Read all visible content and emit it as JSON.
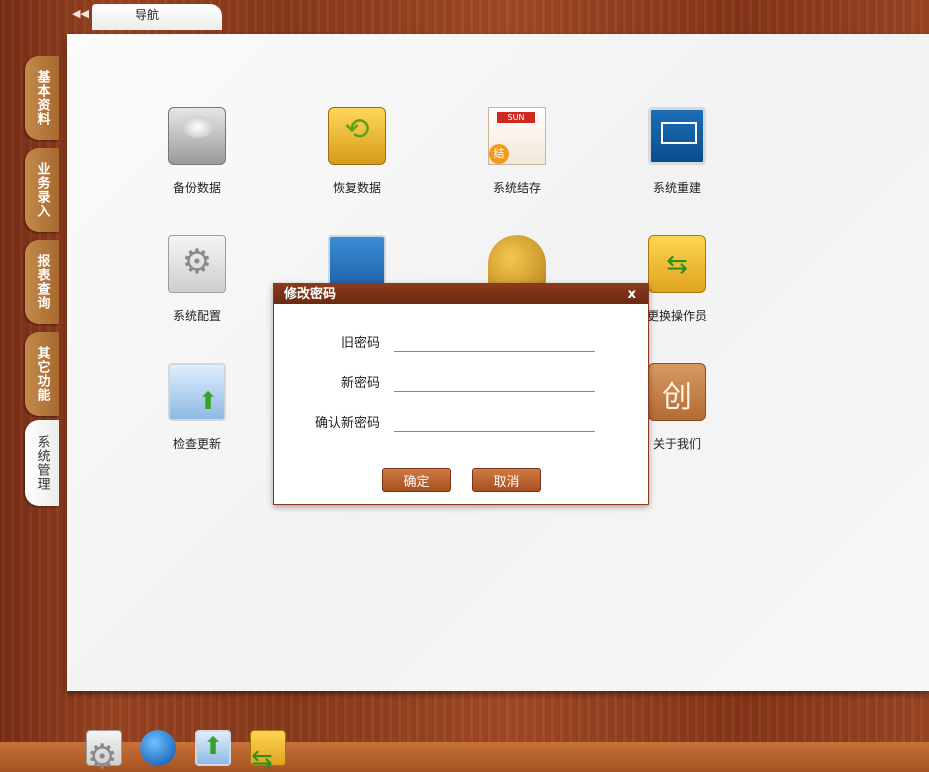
{
  "nav": {
    "collapse_icon": "◀◀",
    "tab_label": "导航"
  },
  "side_tabs": [
    {
      "label": "基本资料",
      "active": false
    },
    {
      "label": "业务录入",
      "active": false
    },
    {
      "label": "报表查询",
      "active": false
    },
    {
      "label": "其它功能",
      "active": false
    },
    {
      "label": "系统管理",
      "active": true
    }
  ],
  "tiles": [
    {
      "label": "备份数据",
      "icon": "backup-disk-icon"
    },
    {
      "label": "恢复数据",
      "icon": "restore-icon"
    },
    {
      "label": "系统结存",
      "icon": "closing-document-icon"
    },
    {
      "label": "系统重建",
      "icon": "monitor-rebuild-icon"
    },
    {
      "label": "系统配置",
      "icon": "gear-icon"
    },
    {
      "label": "",
      "icon": "users-lock-icon"
    },
    {
      "label": "",
      "icon": "key-lock-icon"
    },
    {
      "label": "更换操作员",
      "icon": "switch-operator-icon"
    },
    {
      "label": "检查更新",
      "icon": "update-icon"
    },
    {
      "label": "关于我们",
      "icon": "about-create-icon"
    }
  ],
  "dialog": {
    "title": "修改密码",
    "close": "x",
    "old_password_label": "旧密码",
    "new_password_label": "新密码",
    "confirm_password_label": "确认新密码",
    "old_password_value": "",
    "new_password_value": "",
    "confirm_password_value": "",
    "ok_label": "确定",
    "cancel_label": "取消"
  },
  "dock": [
    "gear-icon",
    "globe-update-icon",
    "update-icon",
    "switch-operator-icon"
  ]
}
